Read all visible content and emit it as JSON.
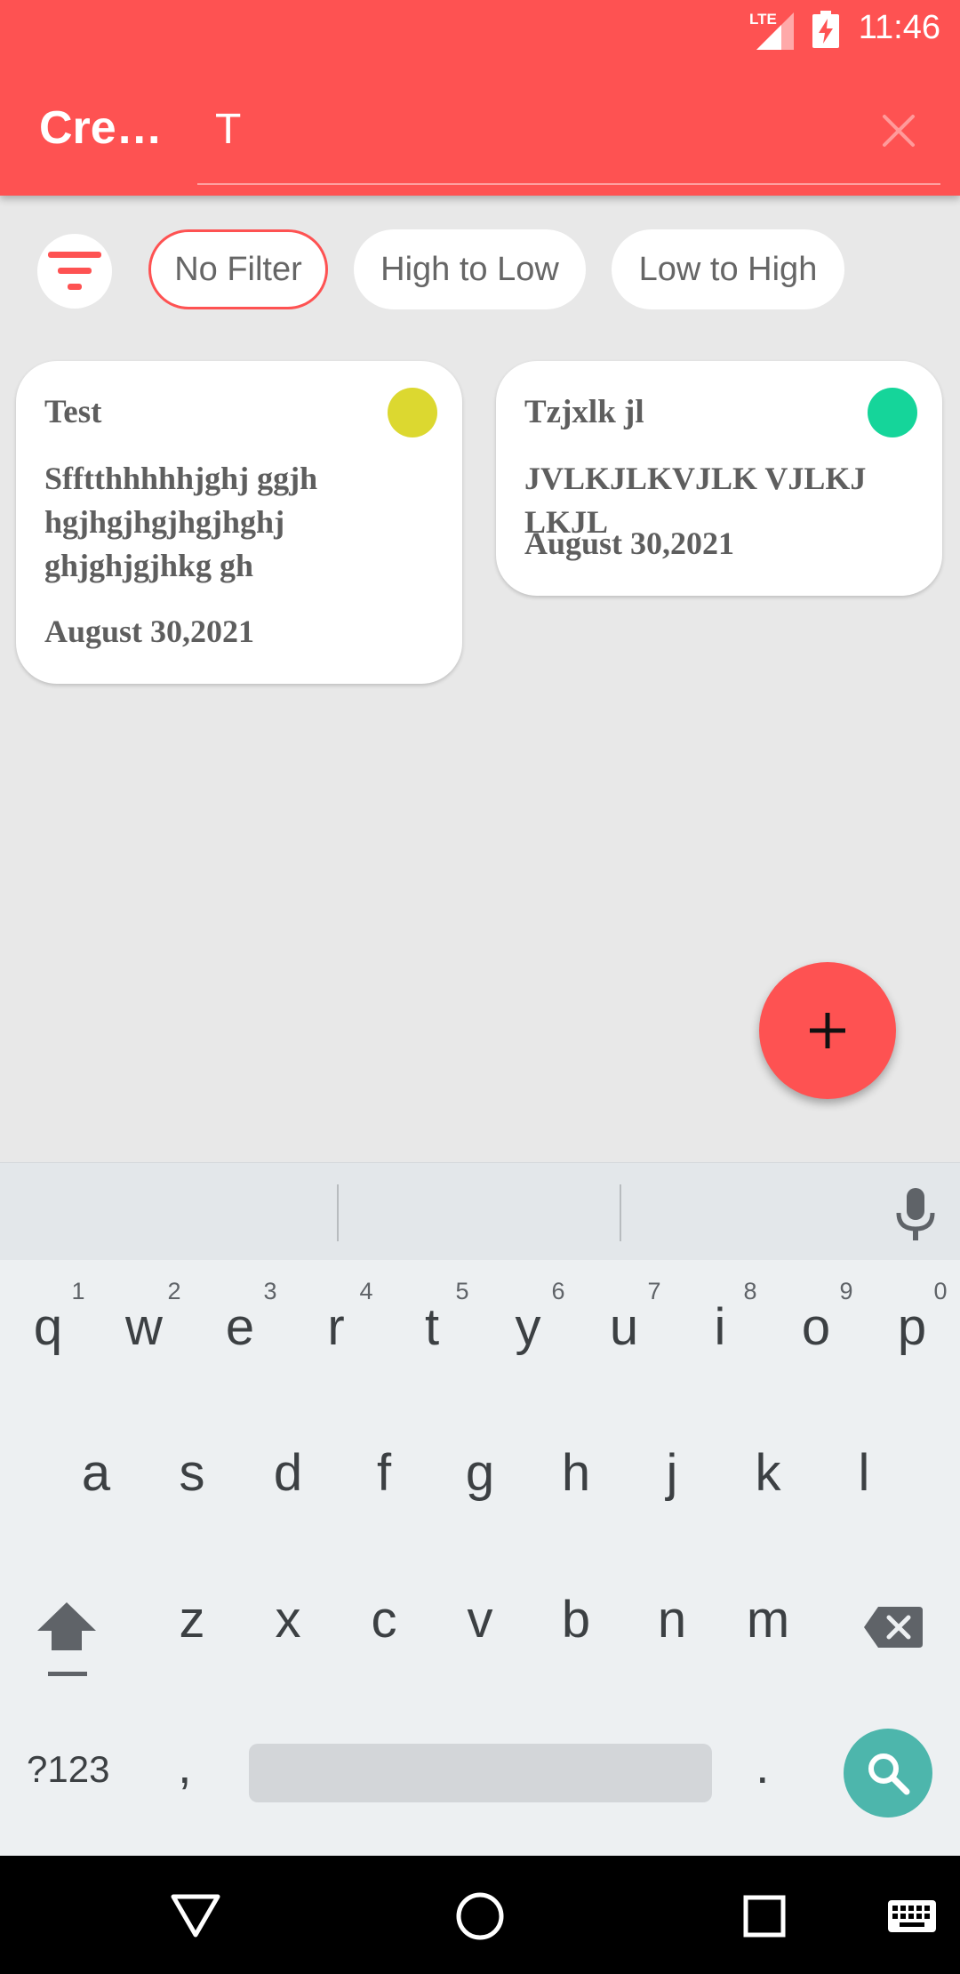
{
  "status": {
    "time": "11:46",
    "network": "LTE"
  },
  "appbar": {
    "title": "Cre…",
    "search_value": "T"
  },
  "filters": {
    "chips": [
      {
        "label": "No Filter",
        "selected": true
      },
      {
        "label": "High to Low",
        "selected": false
      },
      {
        "label": "Low to High",
        "selected": false
      }
    ]
  },
  "notes": [
    {
      "title": "Test",
      "body": "Sfftthhhhhjghj ggjh hgjhgjhgjhgjhghj ghjghjgjhkg gh",
      "date": "August 30,2021",
      "priority_color": "#dcd830"
    },
    {
      "title": "Tzjxlk jl",
      "body": "JVLKJLKVJLK VJLKJ LKJL",
      "date": "August 30,2021",
      "priority_color": "#15d59a"
    }
  ],
  "colors": {
    "accent": "#fe5252",
    "search_key": "#4db6ac"
  },
  "keyboard": {
    "row1": [
      "q",
      "w",
      "e",
      "r",
      "t",
      "y",
      "u",
      "i",
      "o",
      "p"
    ],
    "row1_hints": [
      "1",
      "2",
      "3",
      "4",
      "5",
      "6",
      "7",
      "8",
      "9",
      "0"
    ],
    "row2": [
      "a",
      "s",
      "d",
      "f",
      "g",
      "h",
      "j",
      "k",
      "l"
    ],
    "row3": [
      "z",
      "x",
      "c",
      "v",
      "b",
      "n",
      "m"
    ],
    "symbols_label": "?123",
    "comma": ",",
    "period": "."
  },
  "icons": {
    "filter": "filter-icon",
    "clear": "close-icon",
    "add": "plus-icon",
    "mic": "microphone-icon",
    "shift": "shift-icon",
    "backspace": "backspace-icon",
    "search": "search-icon",
    "nav": [
      "back-icon",
      "home-icon",
      "recents-icon",
      "keyboard-icon"
    ]
  }
}
